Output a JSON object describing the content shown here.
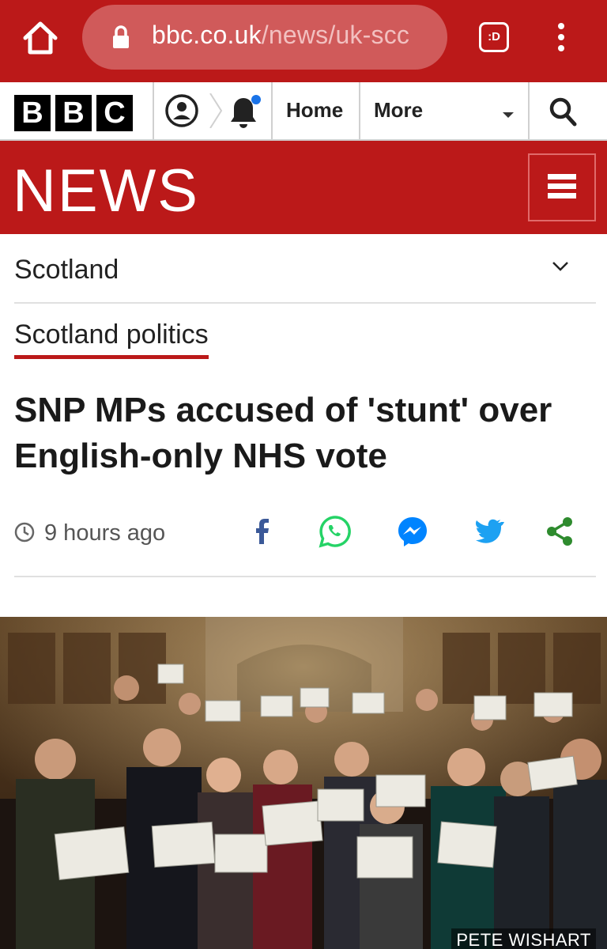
{
  "browser": {
    "url_host": "bbc.co.uk",
    "url_path": "/news/uk-scc",
    "tab_switcher_label": ":D"
  },
  "nav": {
    "logo_letters": [
      "B",
      "B",
      "C"
    ],
    "home_label": "Home",
    "more_label": "More"
  },
  "banner": {
    "title": "NEWS"
  },
  "section": {
    "label": "Scotland"
  },
  "subsection": {
    "label": "Scotland politics"
  },
  "article": {
    "headline": "SNP MPs accused of 'stunt' over English-only NHS vote",
    "timestamp": "9 hours ago",
    "photo_credit": "PETE WISHART"
  },
  "share_icons": [
    "facebook-icon",
    "whatsapp-icon",
    "messenger-icon",
    "twitter-icon",
    "share-icon"
  ],
  "colors": {
    "brand_red": "#bb1919",
    "facebook": "#3b5998",
    "whatsapp": "#25d366",
    "messenger": "#0084ff",
    "twitter": "#1da1f2",
    "share": "#2e8b2e",
    "notification_dot": "#1a73e8"
  }
}
